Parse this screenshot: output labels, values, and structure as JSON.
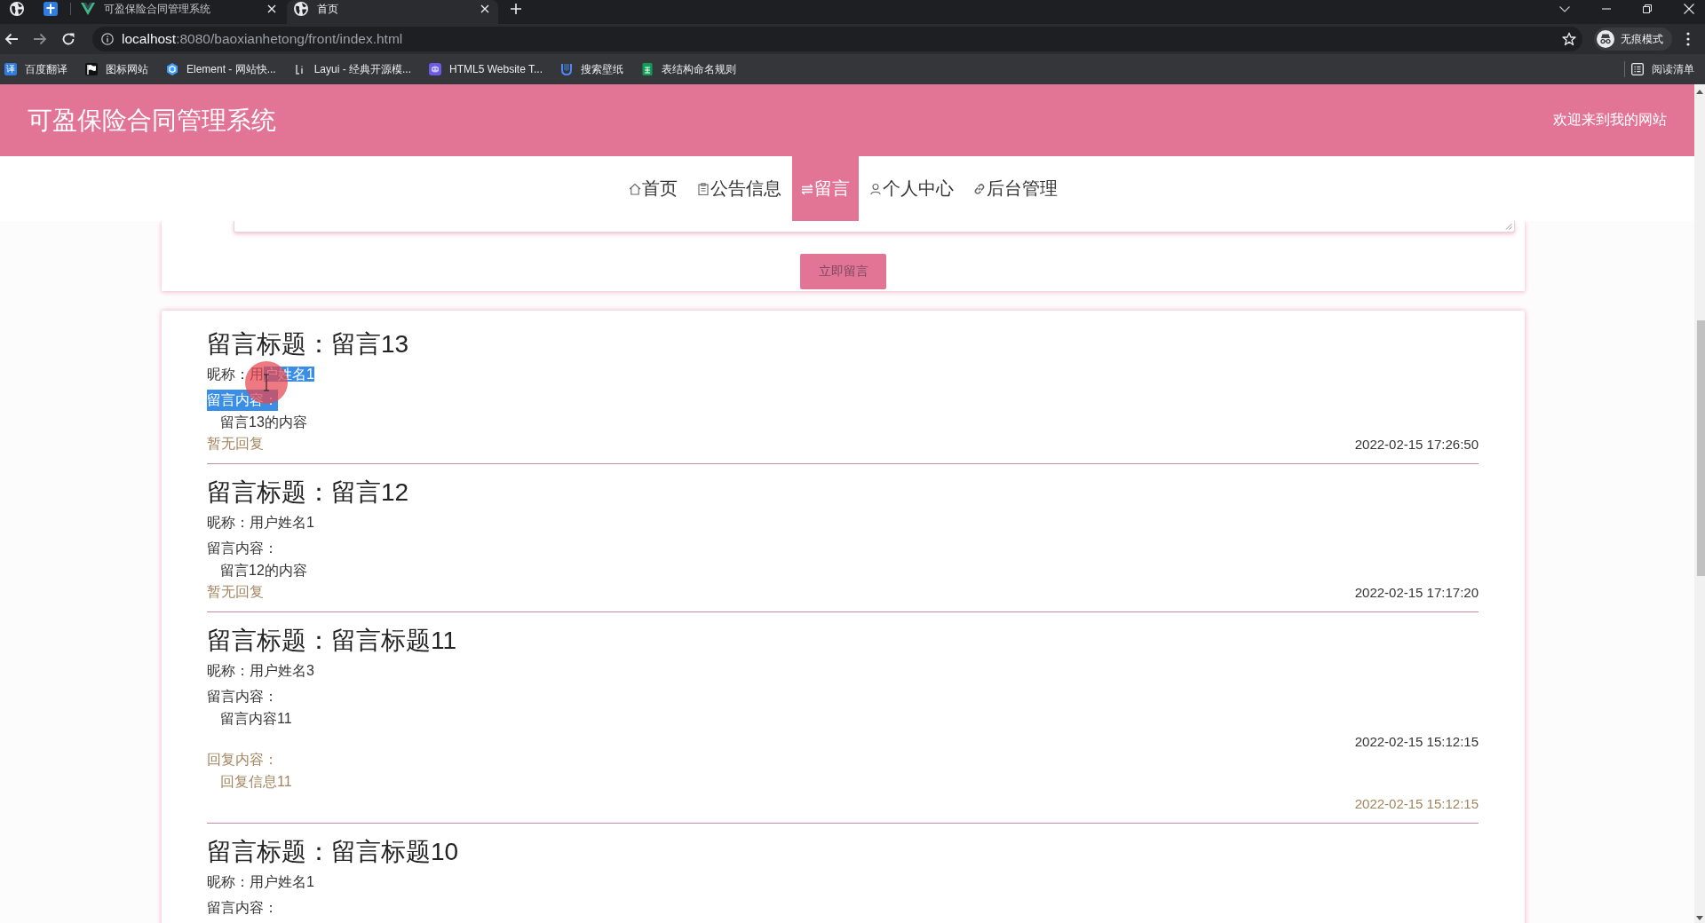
{
  "browser": {
    "tabs": [
      {
        "title": "可盈保险合同管理系统",
        "selected": false
      },
      {
        "title": "首页",
        "selected": true
      }
    ],
    "address": {
      "host": "localhost",
      "path": ":8080/baoxianhetong/front/index.html"
    },
    "profile": "无痕模式",
    "bookmarks": [
      {
        "label": "百度翻译",
        "icon_text": "译"
      },
      {
        "label": "图标网站"
      },
      {
        "label": "Element - 网站快..."
      },
      {
        "label": "Layui - 经典开源模..."
      },
      {
        "label": "HTML5 Website T..."
      },
      {
        "label": "搜索壁纸"
      },
      {
        "label": "表结构命名规则"
      }
    ],
    "reading_list": "阅读清单"
  },
  "header": {
    "title": "可盈保险合同管理系统",
    "welcome": "欢迎来到我的网站"
  },
  "nav": [
    {
      "label": "首页",
      "selected": false
    },
    {
      "label": "公告信息",
      "selected": false
    },
    {
      "label": "留言",
      "selected": true
    },
    {
      "label": "个人中心",
      "selected": false
    },
    {
      "label": "后台管理",
      "selected": false
    }
  ],
  "form": {
    "submit": "立即留言"
  },
  "messages": [
    {
      "title_label": "留言标题：",
      "title": "留言13",
      "nickname_label": "昵称：",
      "nickname": [
        {
          "text": "用",
          "highlighted": false
        },
        {
          "text": "户姓名1",
          "highlighted": true
        }
      ],
      "content_label": "留言内容：",
      "content_label_highlighted": true,
      "content": "留言13的内容",
      "reply": {
        "kind": "none",
        "text": "暂无回复"
      },
      "time": "2022-02-15 17:26:50"
    },
    {
      "title_label": "留言标题：",
      "title": "留言12",
      "nickname_label": "昵称：",
      "nickname": [
        {
          "text": "用户姓名1",
          "highlighted": false
        }
      ],
      "content_label": "留言内容：",
      "content_label_highlighted": false,
      "content": "留言12的内容",
      "reply": {
        "kind": "none",
        "text": "暂无回复"
      },
      "time": "2022-02-15 17:17:20"
    },
    {
      "title_label": "留言标题：",
      "title": "留言标题11",
      "nickname_label": "昵称：",
      "nickname": [
        {
          "text": "用户姓名3",
          "highlighted": false
        }
      ],
      "content_label": "留言内容：",
      "content_label_highlighted": false,
      "content": "留言内容11",
      "reply": {
        "kind": "reply",
        "label": "回复内容：",
        "text": "回复信息11",
        "time": "2022-02-15 15:12:15"
      },
      "time": "2022-02-15 15:12:15"
    },
    {
      "title_label": "留言标题：",
      "title": "留言标题10",
      "nickname_label": "昵称：",
      "nickname": [
        {
          "text": "用户姓名1",
          "highlighted": false
        }
      ],
      "content_label": "留言内容：",
      "content_label_highlighted": false
    }
  ]
}
